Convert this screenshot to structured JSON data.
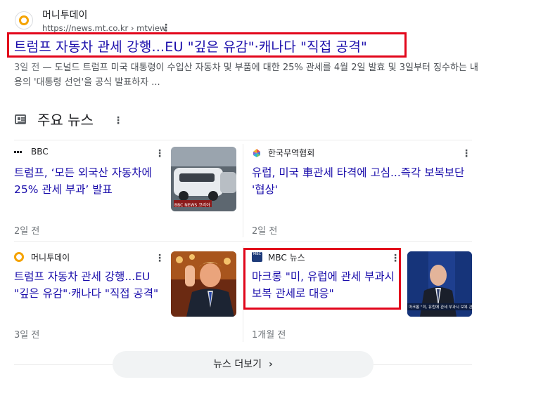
{
  "result": {
    "site_name": "머니투데이",
    "url": "https://news.mt.co.kr › mtview",
    "title": "트럼프 자동차 관세 강행...EU \"깊은 유감\"·캐나다 \"직접 공격\"",
    "snippet_date": "3일 전",
    "snippet_text": " — 도널드 트럼프 미국 대통령이 수입산 자동차 및 부품에 대한 25% 관세를 4월 2일 발효 및 3일부터 징수하는 내용의 '대통령 선언'을 공식 발표하자 ..."
  },
  "section": {
    "title": "주요 뉴스"
  },
  "cards": [
    {
      "source": "BBC",
      "title": "트럼프, ‘모든 외국산 자동차에 25% 관세 부과’ 발표",
      "date": "2일 전",
      "thumb_caption": "BBC NEWS 코리아"
    },
    {
      "source": "한국무역협회",
      "title": "유럽, 미국 車관세 타격에 고심...즉각 보복보단 '협상'",
      "date": "2일 전"
    },
    {
      "source": "머니투데이",
      "title": "트럼프 자동차 관세 강행...EU \"깊은 유감\"·캐나다 \"직접 공격\"",
      "date": "3일 전"
    },
    {
      "source": "MBC 뉴스",
      "title": "마크롱 \"미, 유럽에 관세 부과시 보복 관세로 대응\"",
      "date": "1개월 전",
      "thumb_caption": "마크롱 \"미, 유럽에 관세 부과시 보복 관세로..."
    }
  ],
  "more_button": {
    "label": "뉴스 더보기"
  },
  "colors": {
    "link": "#1a0dab",
    "highlight_box": "#e2061b",
    "meta": "#70757a"
  }
}
